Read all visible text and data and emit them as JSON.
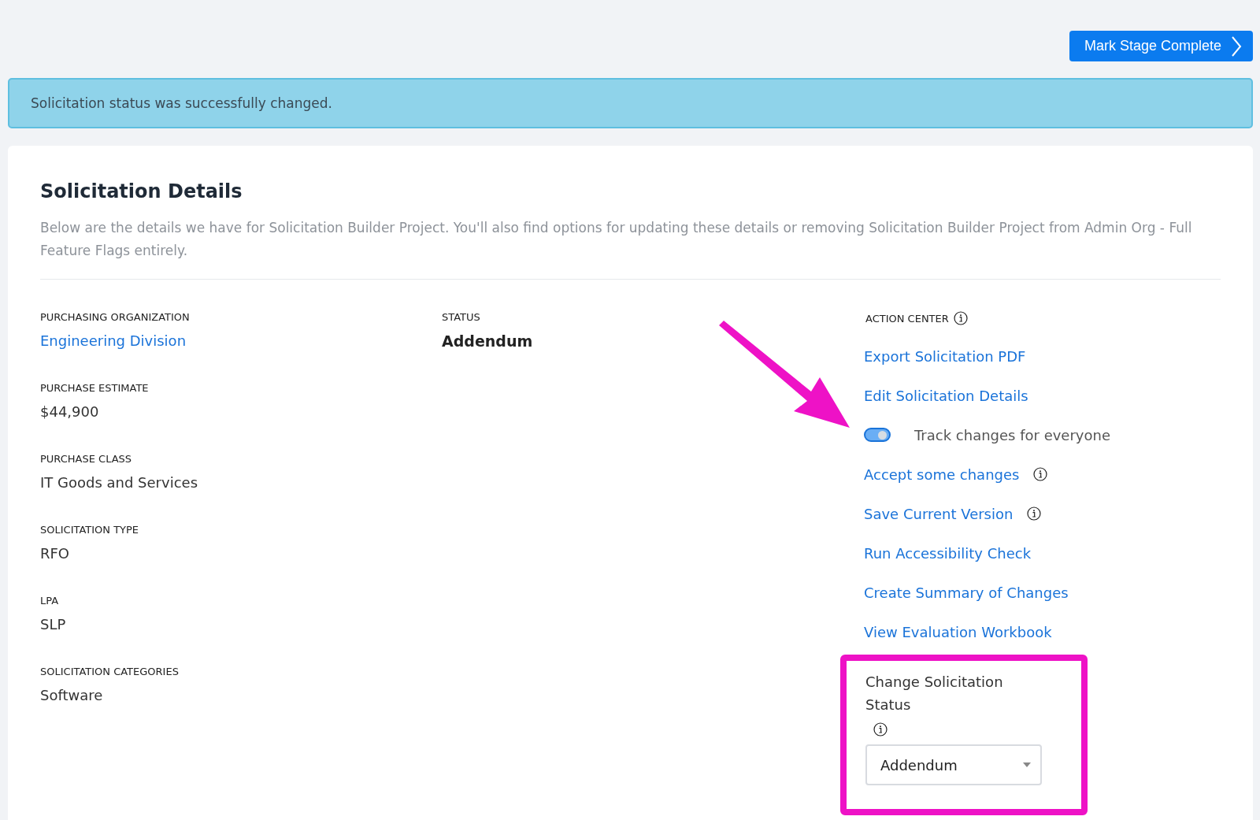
{
  "header_button": {
    "label": "Mark Stage Complete"
  },
  "alert": {
    "message": "Solicitation status was successfully changed."
  },
  "details": {
    "title": "Solicitation Details",
    "description": "Below are the details we have for Solicitation Builder Project. You'll also find options for updating these details or removing Solicitation Builder Project from Admin Org - Full Feature Flags entirely.",
    "fields": [
      {
        "label": "PURCHASING ORGANIZATION",
        "value": "Engineering Division",
        "kind": "link"
      },
      {
        "label": "PURCHASE ESTIMATE",
        "value": "$44,900",
        "kind": "text"
      },
      {
        "label": "PURCHASE CLASS",
        "value": "IT Goods and Services",
        "kind": "text"
      },
      {
        "label": "SOLICITATION TYPE",
        "value": "RFO",
        "kind": "text"
      },
      {
        "label": "LPA",
        "value": "SLP",
        "kind": "text"
      },
      {
        "label": "SOLICITATION CATEGORIES",
        "value": "Software",
        "kind": "text"
      }
    ],
    "status": {
      "label": "STATUS",
      "value": "Addendum"
    },
    "action_center": {
      "title": "ACTION CENTER",
      "items": [
        {
          "kind": "link",
          "label": "Export Solicitation PDF",
          "info": false
        },
        {
          "kind": "link",
          "label": "Edit Solicitation Details",
          "info": false
        },
        {
          "kind": "toggle",
          "label": "Track changes for everyone",
          "on": true
        },
        {
          "kind": "link",
          "label": "Accept some changes",
          "info": true
        },
        {
          "kind": "link",
          "label": "Save Current Version",
          "info": true
        },
        {
          "kind": "link",
          "label": "Run Accessibility Check",
          "info": false
        },
        {
          "kind": "link",
          "label": "Create Summary of Changes",
          "info": false
        },
        {
          "kind": "link",
          "label": "View Evaluation Workbook",
          "info": false
        }
      ]
    },
    "change_status": {
      "label": "Change Solicitation Status",
      "value": "Addendum",
      "highlighted": true
    }
  },
  "annotations": [
    {
      "kind": "arrow"
    }
  ]
}
